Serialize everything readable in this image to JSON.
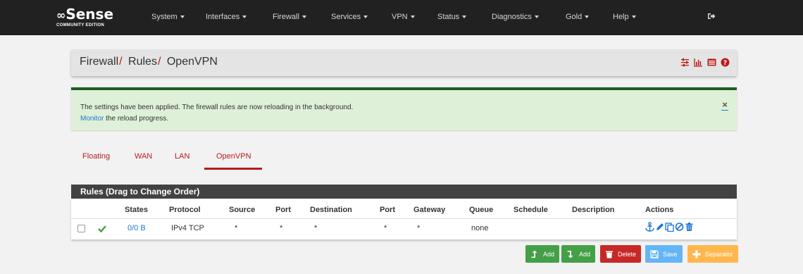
{
  "brand": {
    "logo_text": "Sense",
    "edition": "COMMUNITY EDITION"
  },
  "nav": {
    "items": [
      {
        "label": "System"
      },
      {
        "label": "Interfaces"
      },
      {
        "label": "Firewall"
      },
      {
        "label": "Services"
      },
      {
        "label": "VPN"
      },
      {
        "label": "Status"
      },
      {
        "label": "Diagnostics"
      },
      {
        "label": "Gold"
      },
      {
        "label": "Help"
      }
    ],
    "logout_icon": "sign-out-icon"
  },
  "breadcrumb": {
    "items": [
      "Firewall",
      "Rules",
      "OpenVPN"
    ],
    "separator": "/",
    "icons": [
      "sliders-icon",
      "bar-chart-icon",
      "list-icon",
      "question-circle-icon"
    ]
  },
  "alert": {
    "message": "The settings have been applied. The firewall rules are now reloading in the background.",
    "link": "Monitor",
    "suffix": "the reload progress.",
    "close_label": "×"
  },
  "tabs": {
    "items": [
      "Floating",
      "WAN",
      "LAN",
      "OpenVPN"
    ],
    "active": "OpenVPN"
  },
  "rules": {
    "title": "Rules (Drag to Change Order)",
    "headers": [
      "States",
      "Protocol",
      "Source",
      "Port",
      "Destination",
      "Port",
      "Gateway",
      "Queue",
      "Schedule",
      "Description",
      "Actions"
    ],
    "rows": [
      {
        "states": "0/0 B",
        "protocol": "IPv4 TCP",
        "source": "*",
        "source_port": "*",
        "destination": "*",
        "dest_port": "*",
        "gateway": "*",
        "queue": "none",
        "schedule": "",
        "description": ""
      }
    ],
    "action_icons": [
      "anchor-icon",
      "pencil-icon",
      "copy-icon",
      "ban-icon",
      "trash-icon"
    ]
  },
  "buttons": {
    "add_top": "Add",
    "add_bottom": "Add",
    "delete": "Delete",
    "save": "Save",
    "separator": "Separator"
  },
  "colors": {
    "navbar": "#212121",
    "brand_red": "#b71c1c",
    "alert_bg": "#dff0d8",
    "alert_border": "#1b5e20",
    "link_blue": "#1976d2",
    "btn_green": "#43a047",
    "btn_red": "#c62828",
    "btn_blue": "#64b5f6",
    "btn_orange": "#ffb74d"
  }
}
